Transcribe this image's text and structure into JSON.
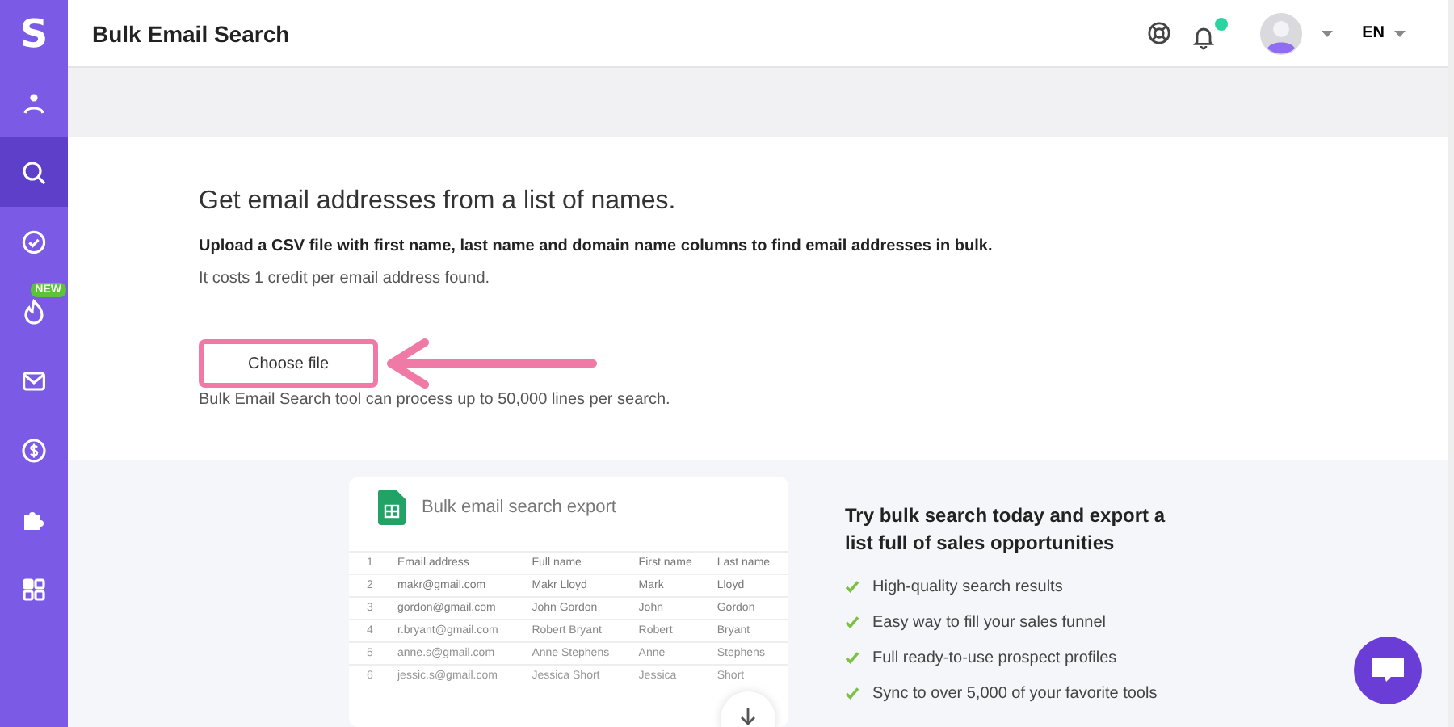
{
  "sidebar": {
    "logo": "S",
    "items": [
      {
        "kind": "user",
        "selected": false
      },
      {
        "kind": "search",
        "selected": true
      },
      {
        "kind": "check",
        "selected": false
      },
      {
        "kind": "fire",
        "selected": false,
        "badge": "NEW"
      },
      {
        "kind": "mail",
        "selected": false
      },
      {
        "kind": "dollar",
        "selected": false
      },
      {
        "kind": "puzzle",
        "selected": false
      },
      {
        "kind": "grid",
        "selected": false
      }
    ]
  },
  "header": {
    "title": "Bulk Email Search",
    "notification": true,
    "language": "EN"
  },
  "upload": {
    "heading": "Get email addresses from a list of names.",
    "instruction": "Upload a CSV file with first name, last name and domain name columns to find email addresses in bulk.",
    "cost": "It costs 1 credit per email address found.",
    "button": "Choose file",
    "limit": "Bulk Email Search tool can process up to 50,000 lines per search."
  },
  "preview": {
    "title": "Bulk email search export",
    "header_num": "1",
    "columns": [
      "Email address",
      "Full name",
      "First name",
      "Last name"
    ],
    "rows": [
      {
        "num": "2",
        "cells": [
          "makr@gmail.com",
          "Makr Lloyd",
          "Mark",
          "Lloyd"
        ]
      },
      {
        "num": "3",
        "cells": [
          "gordon@gmail.com",
          "John Gordon",
          "John",
          "Gordon"
        ]
      },
      {
        "num": "4",
        "cells": [
          "r.bryant@gmail.com",
          "Robert Bryant",
          "Robert",
          "Bryant"
        ]
      },
      {
        "num": "5",
        "cells": [
          "anne.s@gmail.com",
          "Anne Stephens",
          "Anne",
          "Stephens"
        ]
      },
      {
        "num": "6",
        "cells": [
          "jessic.s@gmail.com",
          "Jessica Short",
          "Jessica",
          "Short"
        ]
      }
    ]
  },
  "promo": {
    "heading": "Try bulk search today and export a list full of sales opportunities",
    "features": [
      "High-quality search results",
      "Easy way to fill your sales funnel",
      "Full ready-to-use prospect profiles",
      "Sync to over 5,000 of your favorite tools"
    ]
  }
}
